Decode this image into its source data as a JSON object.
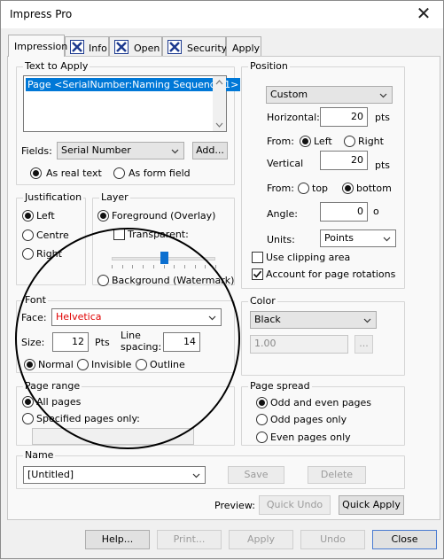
{
  "window": {
    "title": "Impress Pro",
    "close_glyph": "✕"
  },
  "tabs": [
    {
      "label": "Impression",
      "active": true
    },
    {
      "label": "Info",
      "icon": "x-box-icon"
    },
    {
      "label": "Open",
      "icon": "x-box-icon"
    },
    {
      "label": "Security",
      "icon": "x-box-icon"
    },
    {
      "label": "Apply"
    }
  ],
  "text_to_apply": {
    "legend": "Text to Apply",
    "value": "Page <SerialNumber:Naming Sequence 1>",
    "fields_label": "Fields:",
    "fields_value": "Serial Number",
    "add_button": "Add...",
    "as_real_text": "As real text",
    "as_form_field": "As form field",
    "mode": "As real text"
  },
  "position": {
    "legend": "Position",
    "preset": "Custom",
    "horizontal_label": "Horizontal:",
    "horizontal_value": "20",
    "horizontal_units": "pts",
    "from_label": "From:",
    "from_left": "Left",
    "from_right": "Right",
    "from_h": "Left",
    "vertical_label": "Vertical",
    "vertical_value": "20",
    "vertical_units": "pts",
    "from_label_v": "From:",
    "from_top": "top",
    "from_bottom": "bottom",
    "from_v": "bottom",
    "angle_label": "Angle:",
    "angle_value": "0",
    "angle_units": "o",
    "units_label": "Units:",
    "units_value": "Points",
    "use_clipping": "Use clipping area",
    "use_clipping_checked": false,
    "account_rotations": "Account for page rotations",
    "account_rotations_checked": true
  },
  "justification": {
    "legend": "Justification",
    "left": "Left",
    "centre": "Centre",
    "right": "Right",
    "selected": "Left"
  },
  "layer": {
    "legend": "Layer",
    "foreground": "Foreground (Overlay)",
    "transparent": "Transparent:",
    "transparent_checked": false,
    "background": "Background (Watermark)",
    "selected": "Foreground (Overlay)",
    "transparency_level": 0.5
  },
  "font": {
    "legend": "Font",
    "face_label": "Face:",
    "face_value": "Helvetica",
    "face_color": "#e00000",
    "size_label": "Size:",
    "size_value": "12",
    "size_units": "Pts",
    "line_spacing_label_1": "Line",
    "line_spacing_label_2": "spacing:",
    "line_spacing_value": "14",
    "normal": "Normal",
    "invisible": "Invisible",
    "outline": "Outline",
    "style": "Normal"
  },
  "color": {
    "legend": "Color",
    "value": "Black",
    "opacity_value": "1.00",
    "more_button": "..."
  },
  "page_range": {
    "legend": "Page range",
    "all_pages": "All pages",
    "specified_pages": "Specified pages only:",
    "selected": "All pages",
    "specified_value": ""
  },
  "page_spread": {
    "legend": "Page spread",
    "odd_even": "Odd and even pages",
    "odd_only": "Odd pages only",
    "even_only": "Even pages only",
    "selected": "Odd and even pages"
  },
  "name": {
    "legend": "Name",
    "value": "[Untitled]",
    "save_button": "Save",
    "delete_button": "Delete"
  },
  "preview": {
    "label": "Preview:",
    "quick_undo": "Quick Undo",
    "quick_apply": "Quick Apply"
  },
  "footer": {
    "help": "Help...",
    "print": "Print...",
    "apply": "Apply",
    "undo": "Undo",
    "close": "Close"
  },
  "colors": {
    "selection": "#0078d7",
    "annotation_circle": "#000000",
    "tab_icon_border": "#1d3a8f"
  }
}
